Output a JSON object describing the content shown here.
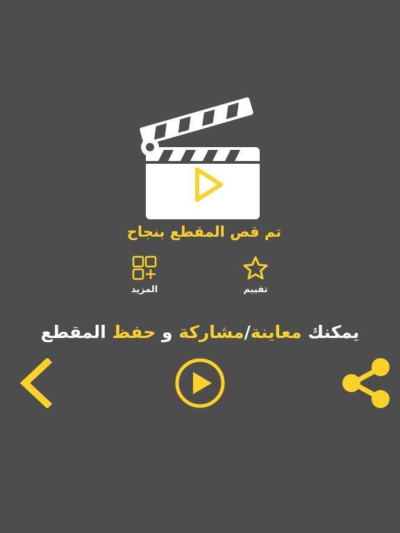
{
  "status": {
    "title": "تم قص المقطع بنجاح"
  },
  "actions": {
    "rate_label": "تقييم",
    "more_label": "المزيد"
  },
  "hint": {
    "part1": "يمكنك ",
    "preview": "معاينة",
    "part2": "/",
    "share": "مشاركة",
    "part3": " و ",
    "save": "حفظ",
    "part4": " المقطع"
  },
  "icons": {
    "clapper": "clapperboard-play-icon",
    "rate": "star-icon",
    "more": "apps-plus-icon",
    "back": "chevron-left-icon",
    "play": "play-circle-icon",
    "share": "share-icon"
  },
  "colors": {
    "background": "#4d4d4d",
    "accent": "#fcd12a",
    "text": "#ffffff"
  }
}
